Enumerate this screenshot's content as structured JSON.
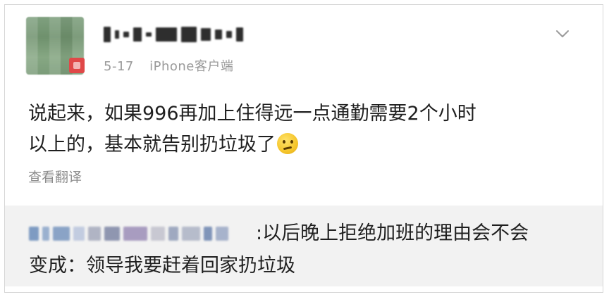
{
  "post": {
    "author_name": "",
    "date": "5-17",
    "client": "iPhone客户端",
    "body_line1": "说起来，如果996再加上住得远一点通勤需要2个小时",
    "body_line2": "以上的，基本就告别扔垃圾了",
    "emoji_icon": "thinking-face-icon",
    "translate_label": "查看翻译"
  },
  "comment": {
    "author_name": "",
    "text_line1": ":以后晚上拒绝加班的理由会不会",
    "text_line2": "变成：领导我要赶着回家扔垃圾"
  },
  "colors": {
    "text_primary": "#1f1f1f",
    "text_secondary": "#9a9a9a",
    "comment_background": "#f2f2f2",
    "avatar_badge": "#e04848"
  }
}
